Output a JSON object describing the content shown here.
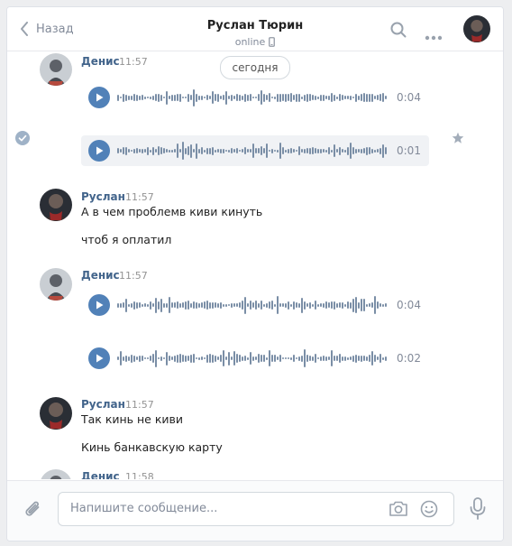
{
  "header": {
    "back_label": "Назад",
    "title": "Руслан Тюрин",
    "status": "online"
  },
  "chat": {
    "date_label": "сегодня",
    "messages": [
      {
        "author": "Денис",
        "time": "11:57",
        "voices": [
          {
            "duration": "0:04"
          },
          {
            "duration": "0:01"
          }
        ]
      },
      {
        "author": "Руслан",
        "time": "11:57",
        "lines": [
          "А в чем проблемв киви кинуть",
          "чтоб я оплатил"
        ]
      },
      {
        "author": "Денис",
        "time": "11:57",
        "voices": [
          {
            "duration": "0:04"
          },
          {
            "duration": "0:02"
          }
        ]
      },
      {
        "author": "Руслан",
        "time": "11:57",
        "lines": [
          "Так кинь не киви",
          "Кинь банкавскую карту"
        ]
      },
      {
        "author": "Денис",
        "time": "11:58"
      }
    ]
  },
  "composer": {
    "placeholder": "Напишите сообщение..."
  },
  "icons": {
    "back": "chevron-left-icon",
    "search": "search-icon",
    "more": "more-dots-icon",
    "mobile": "mobile-phone-icon",
    "selected": "check-circle-icon",
    "favorite": "star-icon",
    "attach": "paperclip-icon",
    "camera": "camera-icon",
    "emoji": "smile-icon",
    "voice": "microphone-icon"
  },
  "colors": {
    "accent": "#5181b8",
    "author_name": "#42648b",
    "muted": "#828a99",
    "selected_row": "#f0f2f5"
  }
}
